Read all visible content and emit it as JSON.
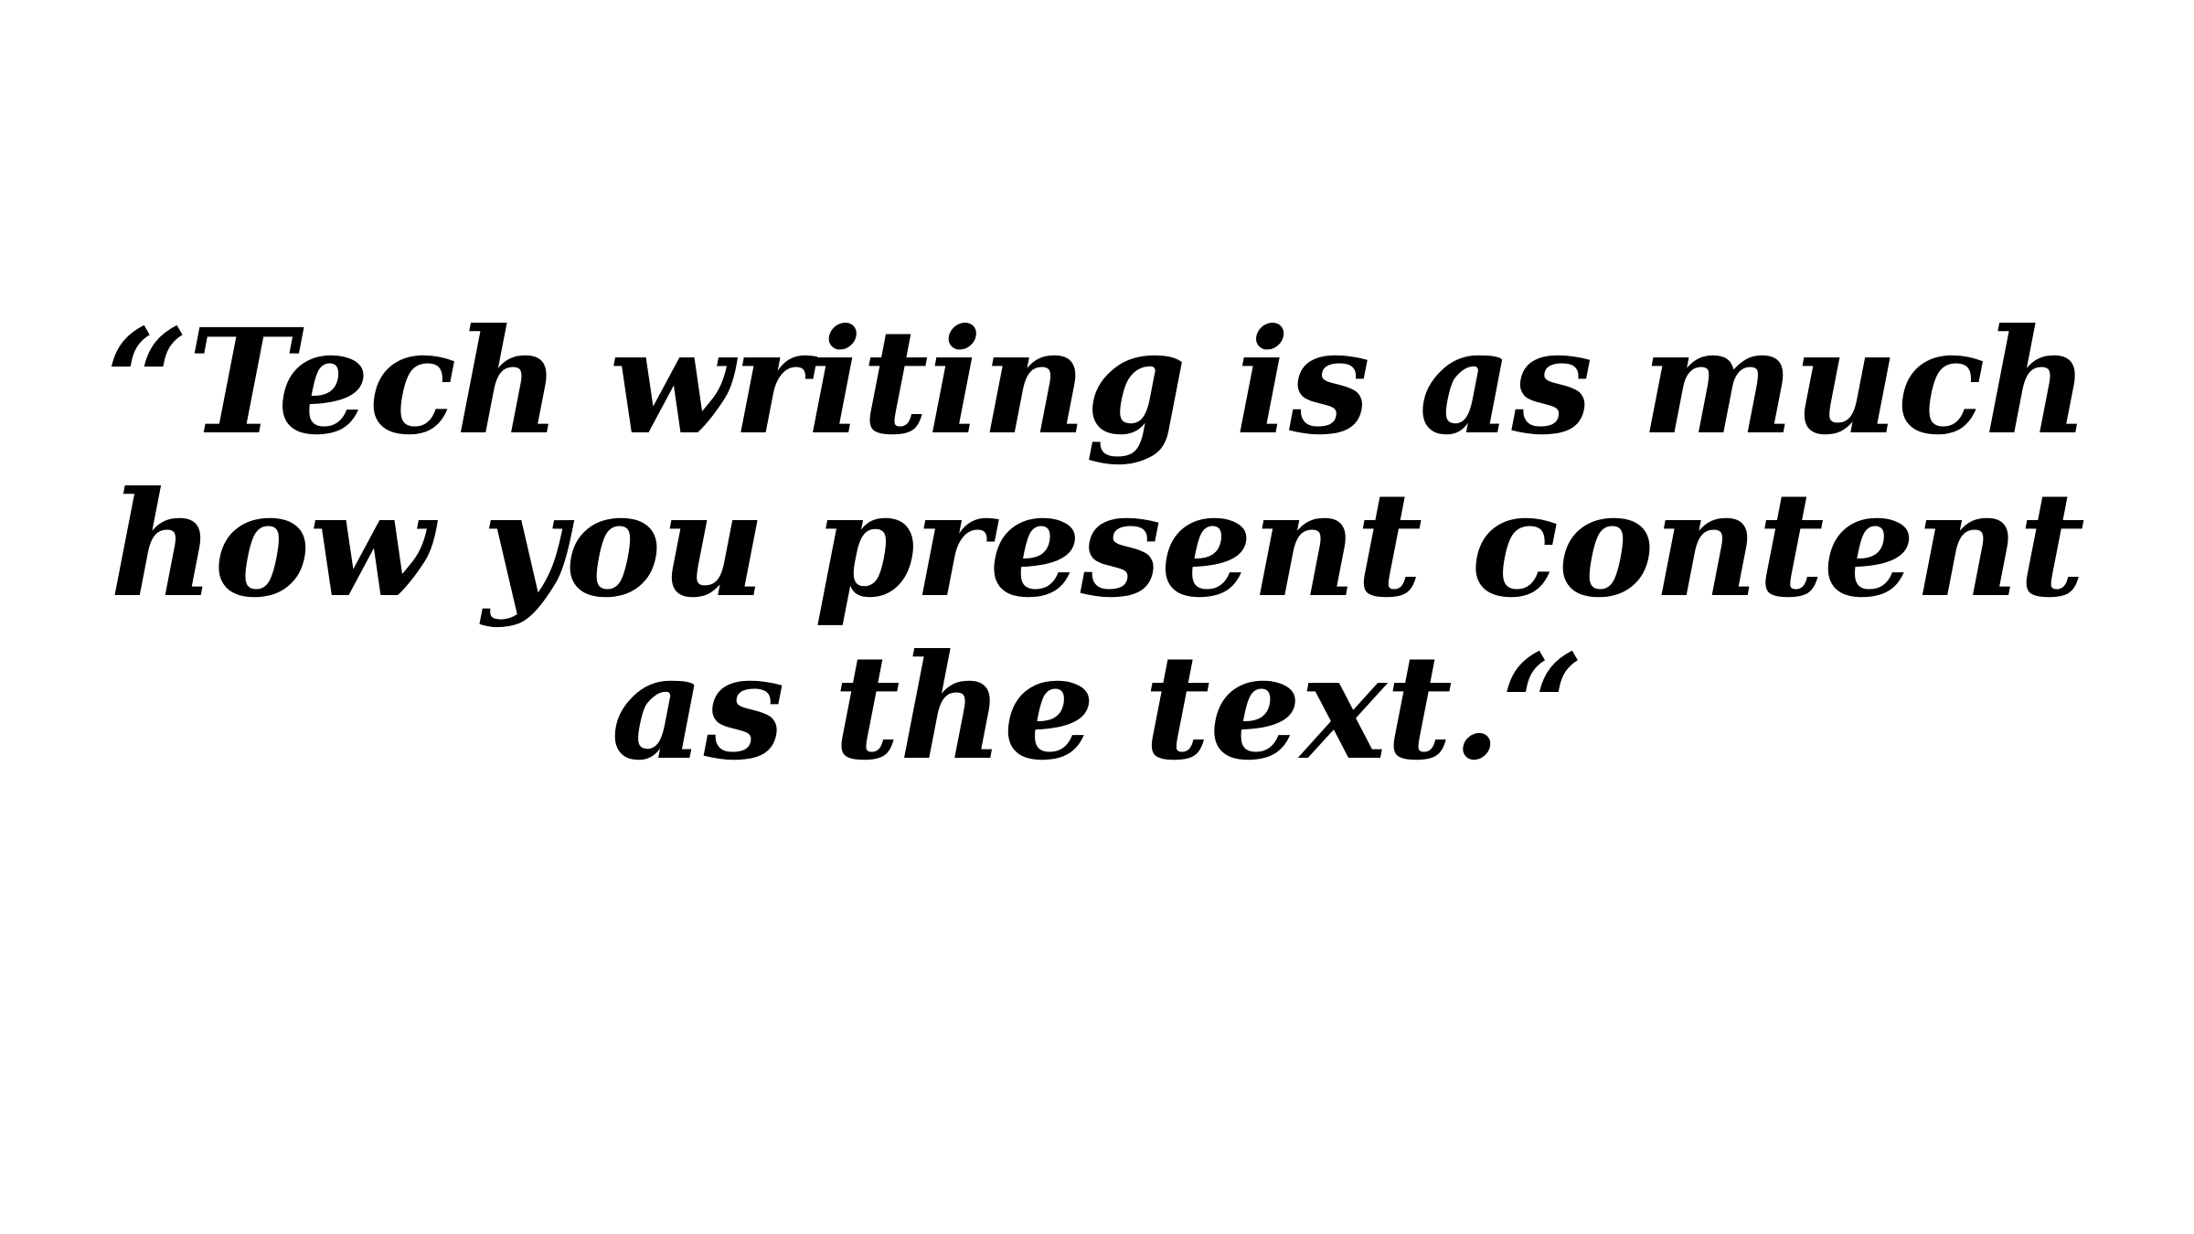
{
  "quote": {
    "lines": [
      "“Tech writing is as much",
      "how you present content",
      "as the text.“"
    ]
  },
  "colors": {
    "background": "#ffffff",
    "text": "#000000"
  }
}
